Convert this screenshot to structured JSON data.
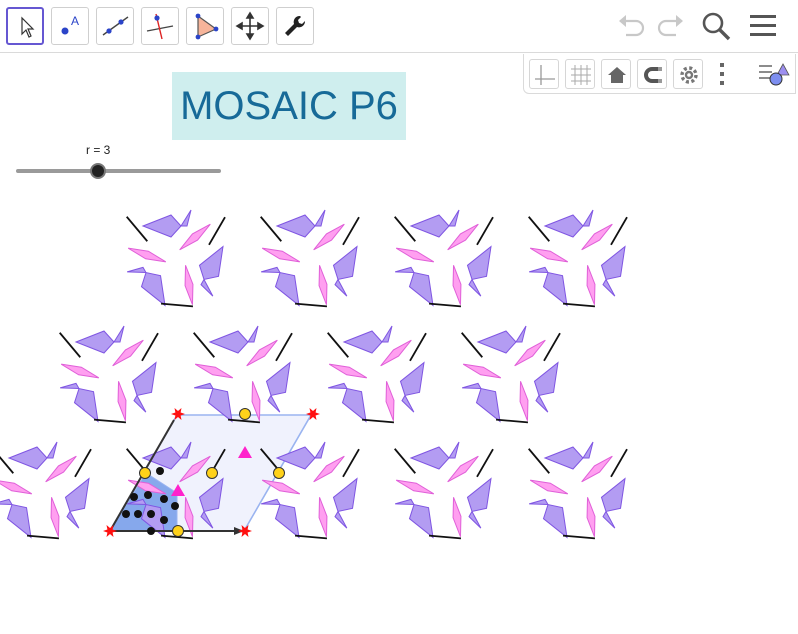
{
  "toolbar": {
    "tools": [
      {
        "name": "move-tool",
        "icon": "pointer-arrow-icon",
        "active": true
      },
      {
        "name": "point-tool",
        "icon": "point-icon",
        "active": false
      },
      {
        "name": "line-tool",
        "icon": "line-icon",
        "active": false
      },
      {
        "name": "perpendicular-line-tool",
        "icon": "perpendicular-line-icon",
        "active": false
      },
      {
        "name": "polygon-tool",
        "icon": "polygon-icon",
        "active": false
      },
      {
        "name": "move-graphics-view-tool",
        "icon": "move-cross-icon",
        "active": false
      },
      {
        "name": "tools-tool",
        "icon": "wrench-icon",
        "active": false
      }
    ],
    "point_tool_letter": "A",
    "right_icons": [
      "undo-icon",
      "redo-icon",
      "search-icon",
      "menu-icon"
    ]
  },
  "stylebar": {
    "buttons": [
      "axes-icon",
      "grid-icon",
      "home-icon",
      "magnet-icon",
      "gear-icon",
      "more-vertical-icon",
      "algebra-view-icon"
    ]
  },
  "title": {
    "text": "MOSAIC P6",
    "background": "#cfeeee",
    "color": "#176a98"
  },
  "slider": {
    "label": "r = 3",
    "value": 3
  },
  "colors": {
    "accent": "#6557d2",
    "kite_fill": "#b39cf2",
    "kite_stroke": "#7f55e2",
    "pink_fill": "#ff9ff0",
    "pink_stroke": "#e060d8",
    "cell_edge": "#9ab4f0",
    "cell_fill": "#f0f2fd",
    "fundamental_fill": "#86a8ec",
    "star_red": "#ff1010",
    "yellow_point": "#ffd21a",
    "magenta_triangle": "#ff22cc"
  }
}
